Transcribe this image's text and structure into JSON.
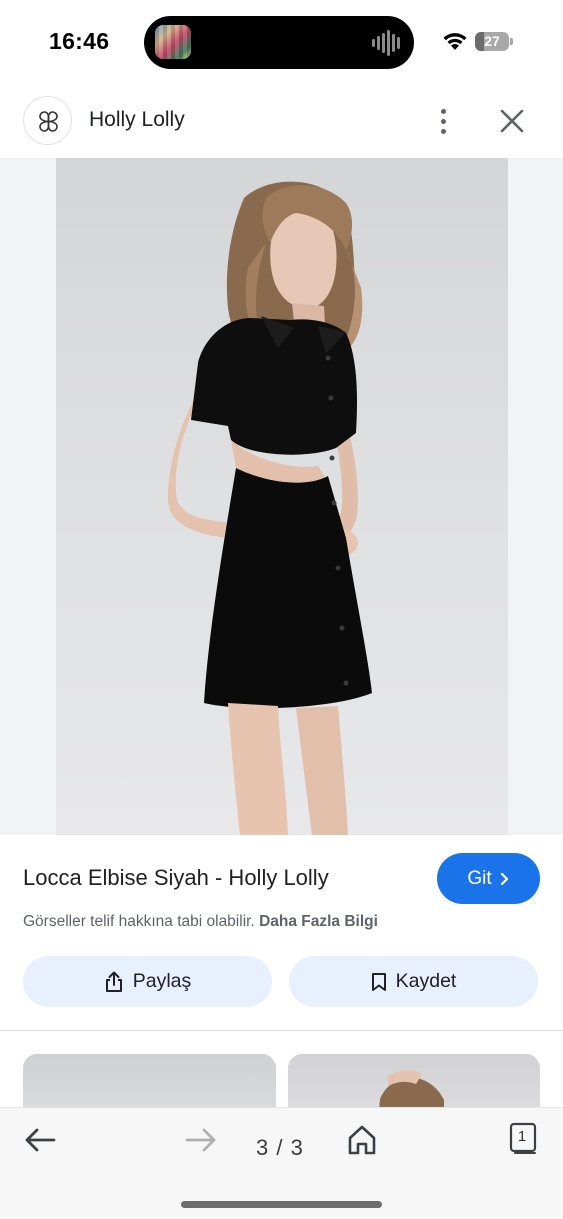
{
  "status_bar": {
    "time": "16:46",
    "battery_level": "27",
    "battery_fraction": 0.27,
    "icons": [
      "now-playing-thumbnail-icon",
      "audio-waveform-icon",
      "wifi-icon",
      "battery-icon"
    ]
  },
  "header": {
    "brand_name": "Holly Lolly",
    "icons": [
      "brand-logo-icon",
      "more-vert-icon",
      "close-icon"
    ]
  },
  "product": {
    "title": "Locca Elbise Siyah - Holly Lolly",
    "visit_label": "Git",
    "copyright_text": "Görseller telif hakkına tabi olabilir.",
    "more_info_link": "Daha Fazla Bilgi",
    "share_label": "Paylaş",
    "save_label": "Kaydet",
    "icons": [
      "chevron-right-icon",
      "share-icon",
      "bookmark-icon"
    ]
  },
  "toolbar": {
    "page_counter": "3 / 3",
    "tab_count": "1",
    "icons": [
      "back-arrow-icon",
      "forward-arrow-icon",
      "home-icon",
      "tabs-icon"
    ]
  },
  "colors": {
    "accent": "#1a73e8",
    "action_bg": "#e8f0fe",
    "text_primary": "#202124",
    "text_secondary": "#5f6368"
  }
}
